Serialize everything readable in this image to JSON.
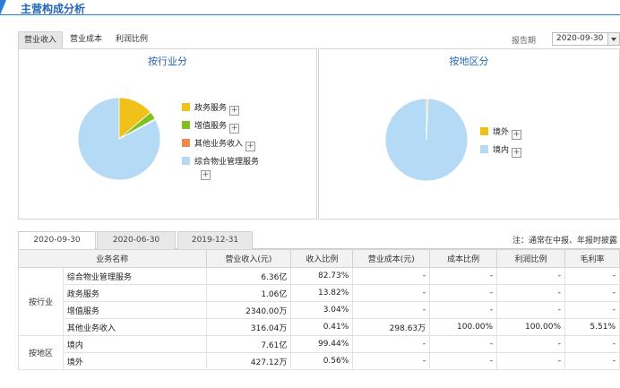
{
  "header": {
    "title": "主营构成分析"
  },
  "tabs": [
    {
      "label": "营业收入"
    },
    {
      "label": "营业成本"
    },
    {
      "label": "利润比例"
    }
  ],
  "period": {
    "label": "报告期",
    "value": "2020-09-30"
  },
  "industry_panel": {
    "title": "按行业分",
    "legend": [
      {
        "label": "政务服务",
        "color": "#f2c119"
      },
      {
        "label": "增值服务",
        "color": "#7fbf1f"
      },
      {
        "label": "其他业务收入",
        "color": "#f08a4b"
      },
      {
        "label": "综合物业管理服务",
        "color": "#b5daf6"
      }
    ]
  },
  "region_panel": {
    "title": "按地区分",
    "legend": [
      {
        "label": "境外",
        "color": "#f2c119"
      },
      {
        "label": "境内",
        "color": "#b5daf6"
      }
    ]
  },
  "chart_data": [
    {
      "type": "pie",
      "title": "按行业分",
      "labels": [
        "综合物业管理服务",
        "政务服务",
        "增值服务",
        "其他业务收入"
      ],
      "values": [
        82.73,
        13.82,
        3.04,
        0.41
      ],
      "colors": [
        "#b5daf6",
        "#f2c119",
        "#7fbf1f",
        "#f08a4b"
      ]
    },
    {
      "type": "pie",
      "title": "按地区分",
      "labels": [
        "境内",
        "境外"
      ],
      "values": [
        99.44,
        0.56
      ],
      "colors": [
        "#b5daf6",
        "#f2c119"
      ]
    }
  ],
  "date_tabs": [
    {
      "label": "2020-09-30"
    },
    {
      "label": "2020-06-30"
    },
    {
      "label": "2019-12-31"
    }
  ],
  "note": "注：通常在中报、年报时披露",
  "table": {
    "headers": [
      "业务名称",
      "营业收入(元)",
      "收入比例",
      "营业成本(元)",
      "成本比例",
      "利润比例",
      "毛利率"
    ],
    "groups": [
      {
        "label": "按行业",
        "rows": [
          [
            "综合物业管理服务",
            "6.36亿",
            "82.73%",
            "-",
            "-",
            "-",
            "-"
          ],
          [
            "政务服务",
            "1.06亿",
            "13.82%",
            "-",
            "-",
            "-",
            "-"
          ],
          [
            "增值服务",
            "2340.00万",
            "3.04%",
            "-",
            "-",
            "-",
            "-"
          ],
          [
            "其他业务收入",
            "316.04万",
            "0.41%",
            "298.63万",
            "100.00%",
            "100.00%",
            "5.51%"
          ]
        ]
      },
      {
        "label": "按地区",
        "rows": [
          [
            "境内",
            "7.61亿",
            "99.44%",
            "-",
            "-",
            "-",
            "-"
          ],
          [
            "境外",
            "427.12万",
            "0.56%",
            "-",
            "-",
            "-",
            "-"
          ]
        ]
      }
    ]
  }
}
